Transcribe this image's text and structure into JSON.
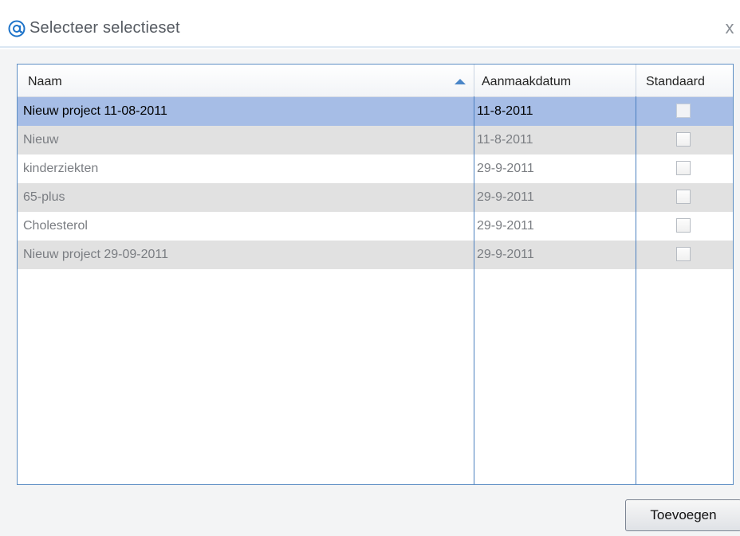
{
  "dialog": {
    "title": "Selecteer selectieset",
    "icon": "at-sign-icon",
    "close_label": "x"
  },
  "grid": {
    "columns": [
      "Naam",
      "Aanmaakdatum",
      "Standaard"
    ],
    "sort_column": "Naam",
    "sort_direction": "ascending",
    "rows": [
      {
        "naam": "Nieuw project 11-08-2011",
        "aanmaakdatum": "11-8-2011",
        "standaard": false,
        "selected": true
      },
      {
        "naam": "Nieuw",
        "aanmaakdatum": "11-8-2011",
        "standaard": false,
        "selected": false
      },
      {
        "naam": "kinderziekten",
        "aanmaakdatum": "29-9-2011",
        "standaard": false,
        "selected": false
      },
      {
        "naam": "65-plus",
        "aanmaakdatum": "29-9-2011",
        "standaard": false,
        "selected": false
      },
      {
        "naam": "Cholesterol",
        "aanmaakdatum": "29-9-2011",
        "standaard": false,
        "selected": false
      },
      {
        "naam": "Nieuw project 29-09-2011",
        "aanmaakdatum": "29-9-2011",
        "standaard": false,
        "selected": false
      }
    ]
  },
  "footer": {
    "add_label": "Toevoegen"
  },
  "colors": {
    "accent": "#1d73c9",
    "selection": "#a6bde6",
    "alt_row": "#e1e1e1",
    "grid_border": "#5d8ec4"
  }
}
